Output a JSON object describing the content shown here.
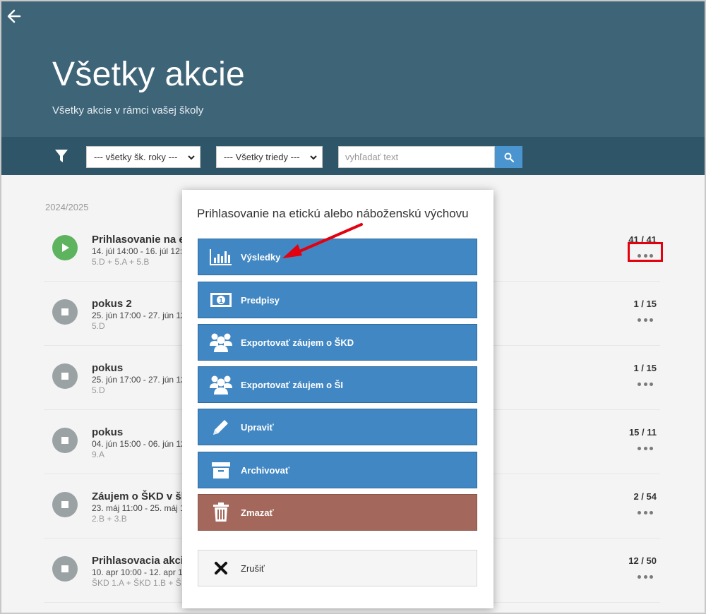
{
  "header": {
    "title": "Všetky akcie",
    "subtitle": "Všetky akcie v rámci vašej školy"
  },
  "filters": {
    "school_years": "--- všetky šk. roky ---",
    "classes": "--- Všetky triedy ---",
    "search_placeholder": "vyhľadať text"
  },
  "year_label": "2024/2025",
  "events": [
    {
      "title": "Prihlasovanie na e",
      "date": "14. júl 14:00 - 16. júl 12:",
      "classes": "5.D + 5.A + 5.B",
      "count": "41 / 41",
      "status": "running"
    },
    {
      "title": "pokus 2",
      "date": "25. jún 17:00 - 27. jún 12",
      "classes": "5.D",
      "count": "1 / 15",
      "status": "stopped"
    },
    {
      "title": "pokus",
      "date": "25. jún 17:00 - 27. jún 12",
      "classes": "5.D",
      "count": "1 / 15",
      "status": "stopped"
    },
    {
      "title": "pokus",
      "date": "04. jún 15:00 - 06. jún 12",
      "classes": "9.A",
      "count": "15 / 11",
      "status": "stopped"
    },
    {
      "title": "Záujem o ŠKD v šk",
      "date": "23. máj 11:00 - 25. máj 1",
      "classes": "2.B + 3.B",
      "count": "2 / 54",
      "status": "stopped"
    },
    {
      "title": "Prihlasovacia akci",
      "date": "10. apr 10:00 - 12. apr 1",
      "classes": "ŠKD 1.A + ŠKD 1.B + Š",
      "count": "12 / 50",
      "status": "stopped"
    }
  ],
  "modal": {
    "title": "Prihlasovanie na etickú alebo náboženskú výchovu",
    "actions": [
      {
        "label": "Výsledky",
        "icon": "bar-chart-icon"
      },
      {
        "label": "Predpisy",
        "icon": "banknote-icon"
      },
      {
        "label": "Exportovať záujem o ŠKD",
        "icon": "users-icon"
      },
      {
        "label": "Exportovať záujem o ŠI",
        "icon": "users-icon"
      },
      {
        "label": "Upraviť",
        "icon": "pencil-icon"
      },
      {
        "label": "Archivovať",
        "icon": "archive-box-icon"
      },
      {
        "label": "Zmazať",
        "icon": "trash-icon"
      }
    ],
    "cancel": {
      "label": "Zrušiť",
      "icon": "close-x-icon"
    }
  },
  "colors": {
    "header_bg": "#3e6478",
    "filterbar_bg": "#2f5568",
    "action_blue": "#4187c3",
    "delete_brown": "#a4675c",
    "status_running": "#5db35e",
    "status_stopped": "#9aa2a3",
    "annotation_red": "#e3000f"
  }
}
